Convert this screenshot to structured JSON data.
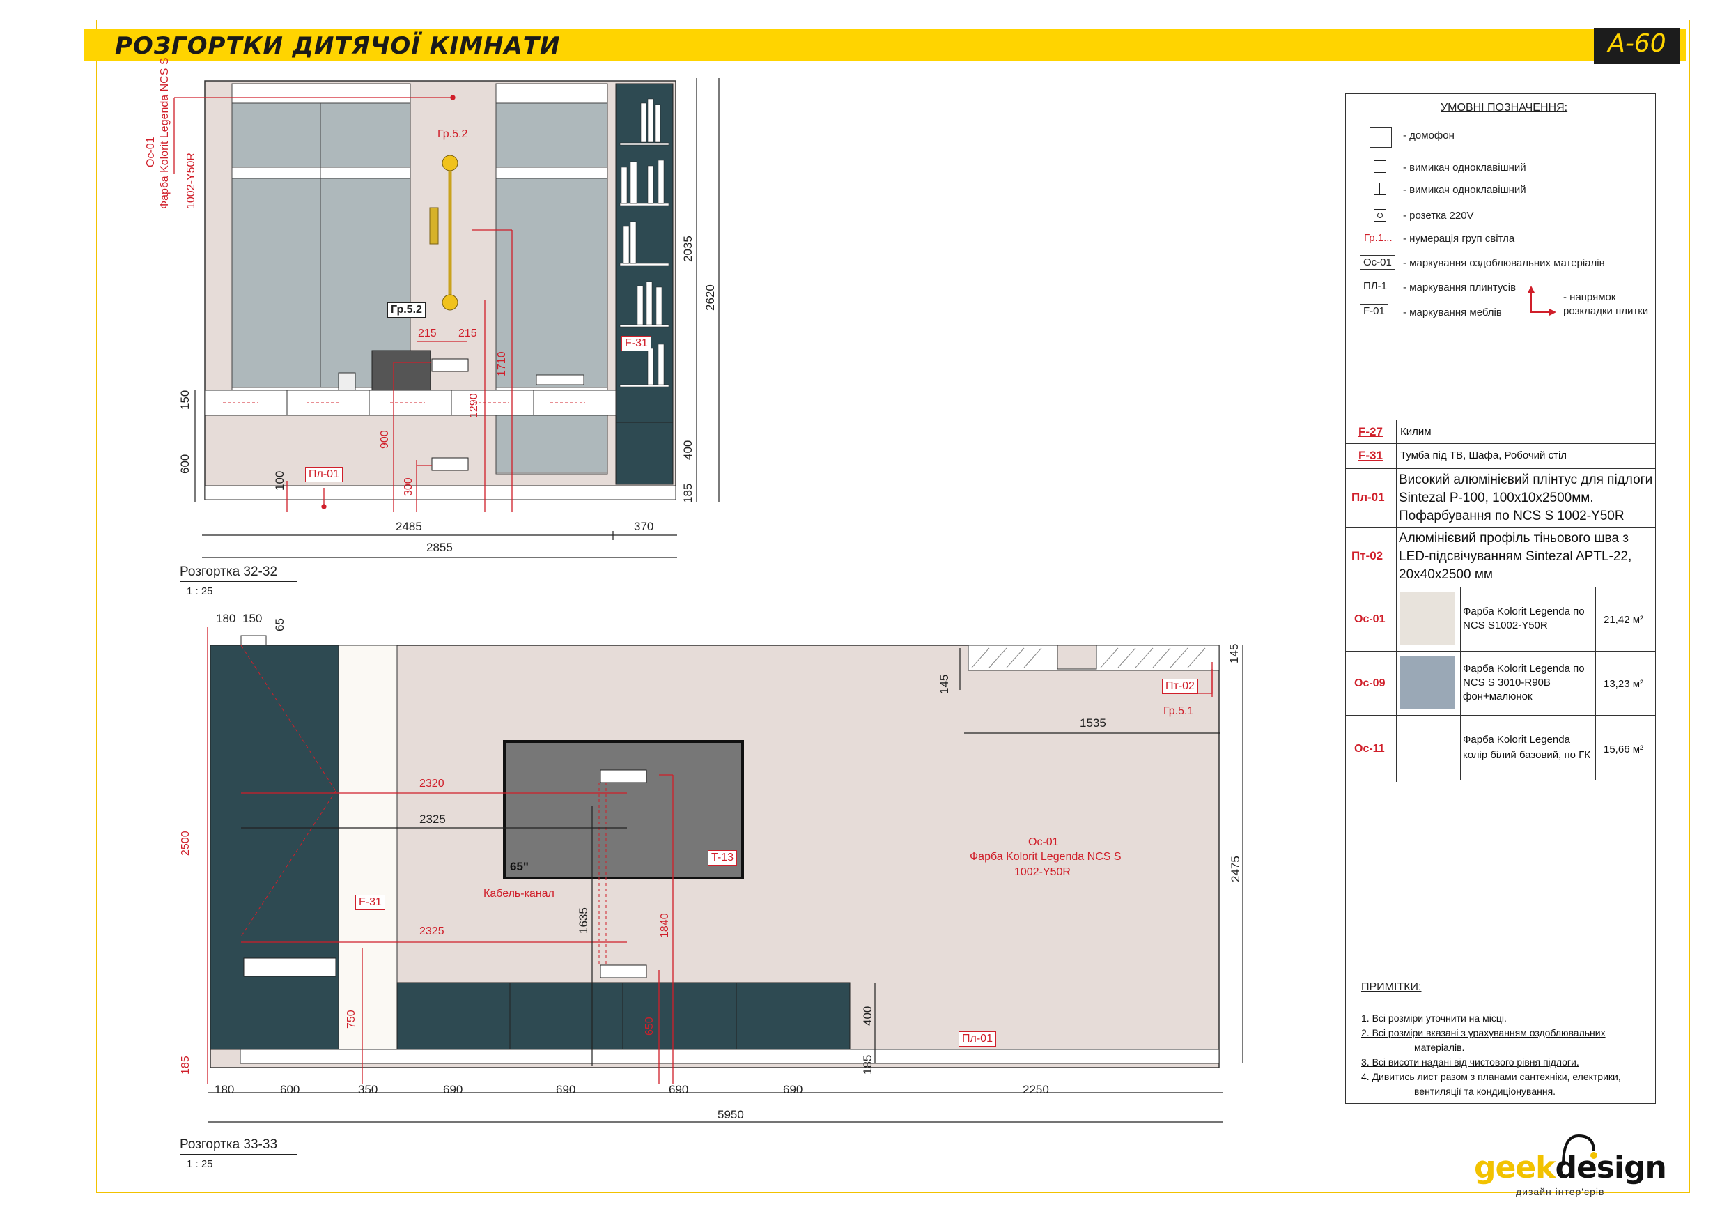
{
  "sheet": {
    "title": "РОЗГОРТКИ ДИТЯЧОЇ КІМНАТИ",
    "code": "А-60"
  },
  "elevation_top": {
    "caption": "Розгортка 32-32",
    "scale": "1 : 25",
    "finish_label": [
      "Ос-01",
      "Фарба Kolorit Legenda NCS S",
      "1002-Y50R"
    ],
    "light_group_a": "Гр.5.2",
    "light_group_b": "Гр.5.2",
    "furniture_tag": "F-31",
    "skirting_tag": "Пл-01",
    "dims": {
      "d215a": "215",
      "d215b": "215",
      "d1710": "1710",
      "d1290": "1290",
      "d900": "900",
      "d300": "300",
      "d100": "100",
      "d150": "150",
      "d600": "600",
      "d2035": "2035",
      "d2620": "2620",
      "d400": "400",
      "d185": "185",
      "d2485": "2485",
      "d370": "370",
      "d2855": "2855"
    }
  },
  "elevation_bottom": {
    "caption": "Розгортка 33-33",
    "scale": "1 : 25",
    "finish_label": [
      "Ос-01",
      "Фарба Kolorit Legenda NCS S",
      "1002-Y50R"
    ],
    "tv_size": "65\"",
    "tv_tag": "T-13",
    "cable_label": "Кабель-канал",
    "furniture_tag": "F-31",
    "skirting_tag": "Пл-01",
    "profile_tag": "Пт-02",
    "light_group": "Гр.5.1",
    "dims": {
      "d180t": "180",
      "d150t": "150",
      "d65": "65",
      "d145a": "145",
      "d145b": "145",
      "d1535": "1535",
      "d2320": "2320",
      "d2325a": "2325",
      "d2325b": "2325",
      "d2500": "2500",
      "d1635": "1635",
      "d1840": "1840",
      "d750": "750",
      "d650": "650",
      "d400": "400",
      "d185a": "185",
      "d185b": "185",
      "d2475": "2475",
      "b180": "180",
      "b600": "600",
      "b350": "350",
      "b690a": "690",
      "b690b": "690",
      "b690c": "690",
      "b690d": "690",
      "b2250": "2250",
      "b5950": "5950"
    }
  },
  "legend": {
    "title": "УМОВНІ ПОЗНАЧЕННЯ:",
    "items": [
      {
        "symbol": "intercom-icon",
        "text": "- домофон"
      },
      {
        "symbol": "switch-single-icon",
        "text": "- вимикач одноклавішний"
      },
      {
        "symbol": "switch-single-icon-2",
        "text": "- вимикач одноклавішний"
      },
      {
        "symbol": "socket-icon",
        "text": "- розетка 220V"
      },
      {
        "symbol": "Гр.1...",
        "text": "- нумерація груп світла"
      },
      {
        "symbol": "Ос-01",
        "text": "- маркування оздоблювальних матеріалів"
      },
      {
        "symbol": "ПЛ-1",
        "text": "- маркування плинтусів"
      },
      {
        "symbol": "F-01",
        "text": "- маркування меблів"
      }
    ],
    "tile_dir_1": "- напрямок",
    "tile_dir_2": "розкладки плитки"
  },
  "spec_table": [
    {
      "code": "F-27",
      "desc": "Килим"
    },
    {
      "code": "F-31",
      "desc": "Тумба під ТВ, Шафа, Робочий стіл"
    },
    {
      "code": "Пл-01",
      "desc": [
        "Високий алюмінієвий плінтус для підлоги",
        "Sintezal P-100, 100х10х2500мм.",
        "Пофарбування по NCS S 1002-Y50R"
      ]
    },
    {
      "code": "Пт-02",
      "desc": [
        "Алюмінієвий профіль тіньового шва з",
        "LED-підсвічуванням Sintezal APTL-22,",
        "20х40х2500 мм"
      ]
    }
  ],
  "paint_table": [
    {
      "code": "Ос-01",
      "swatch": "#e8e3dc",
      "desc": [
        "Фарба Kolorit Legenda по",
        "NCS S1002-Y50R"
      ],
      "area": "21,42 м²"
    },
    {
      "code": "Ос-09",
      "swatch": "#9aa8b6",
      "desc": [
        "Фарба Kolorit  Legenda по",
        "NCS S 3010-R90B",
        "фон+малюнок"
      ],
      "area": "13,23 м²"
    },
    {
      "code": "Ос-11",
      "swatch": "#ffffff",
      "desc": [
        "Фарба Kolorit Legenda",
        "колір білий базовий, по ГК"
      ],
      "area": "15,66 м²"
    }
  ],
  "notes": {
    "title": "ПРИМІТКИ:",
    "items": [
      "1. Всі розміри уточнити на місці.",
      "2. Всі розміри вказані з урахуванням оздоблювальних",
      "матеріалів.",
      "3. Всі висоти надані від чистового рівня підлоги.",
      "4. Дивитись лист разом з планами сантехніки, електрики,",
      "вентиляції та кондиціонування."
    ]
  },
  "logo": {
    "part1": "geek",
    "part2": "design",
    "tagline": "дизайн інтер'єрів"
  },
  "colors": {
    "accent": "#ffd400",
    "dim_red": "#d01f2a",
    "wall": "#e6dcd8",
    "furniture": "#2e4a52",
    "glass": "#aeb8bb",
    "tv": "#777777"
  }
}
